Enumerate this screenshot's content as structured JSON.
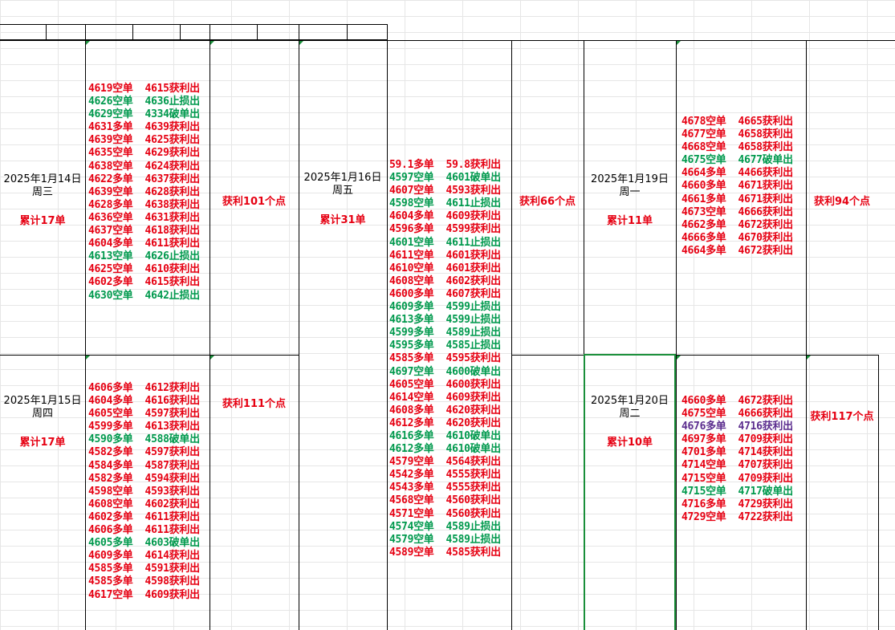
{
  "colors": {
    "profit": "#e60012",
    "stop": "#00994d",
    "special": "#5b2d8e"
  },
  "days": [
    {
      "id": "jan14",
      "date": "2025年1月14日",
      "weekday": "周三",
      "cumulative": "累计17单",
      "profit": "获利101个点",
      "trades": [
        {
          "text": "4619空单  4615获利出",
          "color": "red"
        },
        {
          "text": "4626空单  4636止损出",
          "color": "green"
        },
        {
          "text": "4629空单  4334破单出",
          "color": "green"
        },
        {
          "text": "4631多单  4639获利出",
          "color": "red"
        },
        {
          "text": "4639空单  4625获利出",
          "color": "red"
        },
        {
          "text": "4635空单  4629获利出",
          "color": "red"
        },
        {
          "text": "4638空单  4624获利出",
          "color": "red"
        },
        {
          "text": "4622多单  4637获利出",
          "color": "red"
        },
        {
          "text": "4639空单  4628获利出",
          "color": "red"
        },
        {
          "text": "4628多单  4638获利出",
          "color": "red"
        },
        {
          "text": "4636空单  4631获利出",
          "color": "red"
        },
        {
          "text": "4637空单  4618获利出",
          "color": "red"
        },
        {
          "text": "4604多单  4611获利出",
          "color": "red"
        },
        {
          "text": "4613空单  4626止损出",
          "color": "green"
        },
        {
          "text": "4625空单  4610获利出",
          "color": "red"
        },
        {
          "text": "4602多单  4615获利出",
          "color": "red"
        },
        {
          "text": "4630空单  4642止损出",
          "color": "green"
        }
      ]
    },
    {
      "id": "jan15",
      "date": "2025年1月15日",
      "weekday": "周四",
      "cumulative": "累计17单",
      "profit": "获利111个点",
      "trades": [
        {
          "text": "4606多单  4612获利出",
          "color": "red"
        },
        {
          "text": "4604多单  4616获利出",
          "color": "red"
        },
        {
          "text": "4605空单  4597获利出",
          "color": "red"
        },
        {
          "text": "4599多单  4613获利出",
          "color": "red"
        },
        {
          "text": "4590多单  4588破单出",
          "color": "green"
        },
        {
          "text": "4582多单  4597获利出",
          "color": "red"
        },
        {
          "text": "4584多单  4587获利出",
          "color": "red"
        },
        {
          "text": "4582多单  4594获利出",
          "color": "red"
        },
        {
          "text": "4598空单  4593获利出",
          "color": "red"
        },
        {
          "text": "4608空单  4602获利出",
          "color": "red"
        },
        {
          "text": "4602多单  4611获利出",
          "color": "red"
        },
        {
          "text": "4606多单  4611获利出",
          "color": "red"
        },
        {
          "text": "4605多单  4603破单出",
          "color": "green"
        },
        {
          "text": "4609多单  4614获利出",
          "color": "red"
        },
        {
          "text": "4585多单  4591获利出",
          "color": "red"
        },
        {
          "text": "4585多单  4598获利出",
          "color": "red"
        },
        {
          "text": "4617空单  4609获利出",
          "color": "red"
        }
      ]
    },
    {
      "id": "jan16",
      "date": "2025年1月16日",
      "weekday": "周五",
      "cumulative": "累计31单",
      "profit": "获利66个点",
      "trades": [
        {
          "text": "59.1多单  59.8获利出",
          "color": "red"
        },
        {
          "text": "4597空单  4601破单出",
          "color": "green"
        },
        {
          "text": "4607空单  4593获利出",
          "color": "red"
        },
        {
          "text": "4598空单  4611止损出",
          "color": "green"
        },
        {
          "text": "4604多单  4609获利出",
          "color": "red"
        },
        {
          "text": "4596多单  4599获利出",
          "color": "red"
        },
        {
          "text": "4601空单  4611止损出",
          "color": "green"
        },
        {
          "text": "4611空单  4601获利出",
          "color": "red"
        },
        {
          "text": "4610空单  4601获利出",
          "color": "red"
        },
        {
          "text": "4608空单  4602获利出",
          "color": "red"
        },
        {
          "text": "4600多单  4607获利出",
          "color": "red"
        },
        {
          "text": "4609多单  4599止损出",
          "color": "green"
        },
        {
          "text": "4613多单  4599止损出",
          "color": "green"
        },
        {
          "text": "4599多单  4589止损出",
          "color": "green"
        },
        {
          "text": "4595多单  4585止损出",
          "color": "green"
        },
        {
          "text": "4585多单  4595获利出",
          "color": "red"
        },
        {
          "text": "4697空单  4600破单出",
          "color": "green"
        },
        {
          "text": "4605空单  4600获利出",
          "color": "red"
        },
        {
          "text": "4614空单  4609获利出",
          "color": "red"
        },
        {
          "text": "4608多单  4620获利出",
          "color": "red"
        },
        {
          "text": "4612多单  4620获利出",
          "color": "red"
        },
        {
          "text": "4616多单  4610破单出",
          "color": "green"
        },
        {
          "text": "4612多单  4610破单出",
          "color": "green"
        },
        {
          "text": "4579空单  4564获利出",
          "color": "red"
        },
        {
          "text": "4542多单  4555获利出",
          "color": "red"
        },
        {
          "text": "4543多单  4555获利出",
          "color": "red"
        },
        {
          "text": "4568空单  4560获利出",
          "color": "red"
        },
        {
          "text": "4571空单  4560获利出",
          "color": "red"
        },
        {
          "text": "4574空单  4589止损出",
          "color": "green"
        },
        {
          "text": "4579空单  4589止损出",
          "color": "green"
        },
        {
          "text": "4589空单  4585获利出",
          "color": "red"
        }
      ]
    },
    {
      "id": "jan19",
      "date": "2025年1月19日",
      "weekday": "周一",
      "cumulative": "累计11单",
      "profit": "获利94个点",
      "trades": [
        {
          "text": "4678空单  4665获利出",
          "color": "red"
        },
        {
          "text": "4677空单  4658获利出",
          "color": "red"
        },
        {
          "text": "4668空单  4658获利出",
          "color": "red"
        },
        {
          "text": "4675空单  4677破单出",
          "color": "green"
        },
        {
          "text": "4664多单  4466获利出",
          "color": "red"
        },
        {
          "text": "4660多单  4671获利出",
          "color": "red"
        },
        {
          "text": "4661多单  4671获利出",
          "color": "red"
        },
        {
          "text": "4673空单  4666获利出",
          "color": "red"
        },
        {
          "text": "4662多单  4672获利出",
          "color": "red"
        },
        {
          "text": "4666多单  4670获利出",
          "color": "red"
        },
        {
          "text": "4664多单  4672获利出",
          "color": "red"
        }
      ]
    },
    {
      "id": "jan20",
      "date": "2025年1月20日",
      "weekday": "周二",
      "cumulative": "累计10单",
      "profit": "获利117个点",
      "trades": [
        {
          "text": "4660多单  4672获利出",
          "color": "red"
        },
        {
          "text": "4675空单  4666获利出",
          "color": "red"
        },
        {
          "text": "4676多单  4716获利出",
          "color": "purple"
        },
        {
          "text": "4697多单  4709获利出",
          "color": "red"
        },
        {
          "text": "4701多单  4714获利出",
          "color": "red"
        },
        {
          "text": "4714空单  4707获利出",
          "color": "red"
        },
        {
          "text": "4715空单  4709获利出",
          "color": "red"
        },
        {
          "text": "4715空单  4717破单出",
          "color": "green"
        },
        {
          "text": "4716多单  4729获利出",
          "color": "red"
        },
        {
          "text": "4729空单  4722获利出",
          "color": "red"
        }
      ]
    }
  ]
}
